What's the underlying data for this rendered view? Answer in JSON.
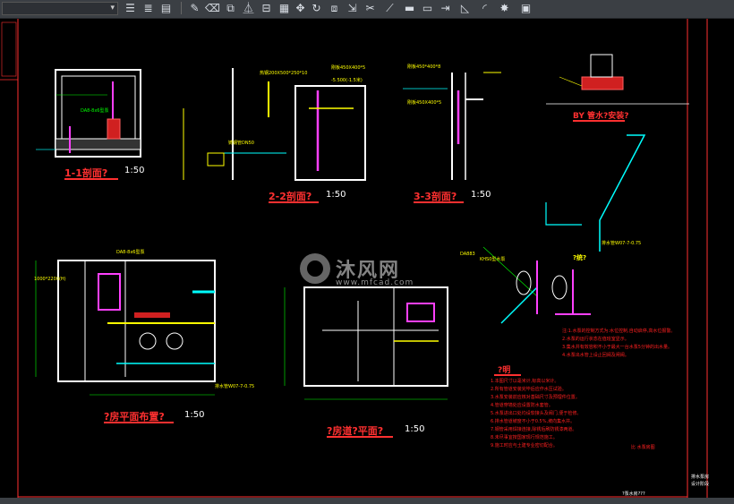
{
  "toolbar": {
    "layer_combo_value": "",
    "tools": [
      "layer-tool-1",
      "layer-tool-2",
      "layer-tool-3",
      "match-prop",
      "erase",
      "copy",
      "mirror",
      "offset",
      "array",
      "move",
      "rotate",
      "scale",
      "stretch",
      "trim",
      "extend",
      "break",
      "join",
      "chamfer",
      "fillet",
      "explode",
      "properties"
    ]
  },
  "drawing": {
    "views": {
      "section11": {
        "title": "1-1剖面?",
        "scale": "1:50"
      },
      "section22": {
        "title": "2-2剖面?",
        "scale": "1:50"
      },
      "section33": {
        "title": "3-3剖面?",
        "scale": "1:50"
      },
      "by_section": {
        "title": "BY 管水?安装?"
      },
      "room_plan": {
        "title": "?房平面布置?",
        "scale": "1:50"
      },
      "pit_plan": {
        "title": "?房道?平面?",
        "scale": "1:50"
      },
      "system_diagram": {
        "title": "?统?"
      }
    },
    "labels": {
      "s22_dim1": "热钢200X500*250*10",
      "s22_dim2": "刚板450X400*5",
      "s22_elev": "-5.500(-1.5米)",
      "s22_pipe": "铸钢管DN50",
      "s33_dim1": "刚板450*400*8",
      "s33_dim2": "刚板450X400*5",
      "s11_pump": "DA8-8x6型泵",
      "plan_pump": "DA8-8x6型泵",
      "plan_tank": "1000*2200(H)",
      "plan_pipe": "排水管W07-7-0.75",
      "sys_pump": "DA883",
      "sys_pipe": "排水管W07-7-0.75",
      "sys_head": "KHS0型水泵"
    },
    "notes_title": "?明",
    "notes": [
      "1.本图尺寸以毫米计,标高以米计。",
      "2.所有管道安装完毕后应作水压试验。",
      "3.水泵安装前应核对基础尺寸及预埋件位置。",
      "4.管道穿墙处应设置防水套管。",
      "5.水泵进出口处均设软接头及阀门,便于检修。",
      "6.排水管道坡度不小于0.5%,坡向集水井。",
      "7.钢管采用焊接连接,除锈后刷防锈漆两道。",
      "8.未尽事宜按国家现行规范施工。",
      "9.施工时应与土建专业密切配合。"
    ],
    "system_notes": [
      "注:1.水泵的控制方式为:水位控制,自动启停,高水位报警。",
      "   2.水泵的运行状态在值班室显示。",
      "   3.集水井有效容积不小于最大一台水泵5分钟的出水量。",
      "   4.水泵出水管上设止回阀及闸阀。"
    ],
    "titleblock": {
      "label1": "排水泵房",
      "label2": "设计阶段",
      "drawing_no": "?泵水房???",
      "small_note": "比 水泵房图"
    },
    "watermark": {
      "cn": "沐风网",
      "url": "www.mfcad.com"
    }
  }
}
